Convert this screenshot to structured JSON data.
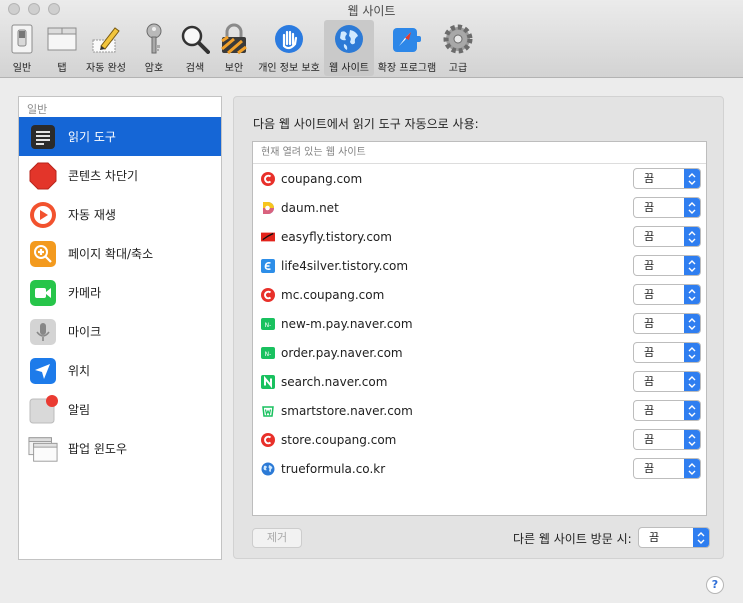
{
  "window": {
    "title": "웹 사이트"
  },
  "toolbar": {
    "items": [
      {
        "label": "일반",
        "icon": "general-switch-icon"
      },
      {
        "label": "탭",
        "icon": "tabs-icon"
      },
      {
        "label": "자동 완성",
        "icon": "pencil-form-icon"
      },
      {
        "label": "암호",
        "icon": "key-icon"
      },
      {
        "label": "검색",
        "icon": "magnifier-icon"
      },
      {
        "label": "보안",
        "icon": "padlock-icon"
      },
      {
        "label": "개인 정보 보호",
        "icon": "hand-icon"
      },
      {
        "label": "웹 사이트",
        "icon": "globe-icon"
      },
      {
        "label": "확장 프로그램",
        "icon": "extensions-icon"
      },
      {
        "label": "고급",
        "icon": "gear-icon"
      }
    ]
  },
  "sidebar": {
    "header": "일반",
    "items": [
      {
        "label": "읽기 도구",
        "icon": "reader-icon"
      },
      {
        "label": "콘텐츠 차단기",
        "icon": "stop-sign-icon"
      },
      {
        "label": "자동 재생",
        "icon": "play-icon"
      },
      {
        "label": "페이지 확대/축소",
        "icon": "zoom-icon"
      },
      {
        "label": "카메라",
        "icon": "camera-icon"
      },
      {
        "label": "마이크",
        "icon": "microphone-icon"
      },
      {
        "label": "위치",
        "icon": "location-icon"
      },
      {
        "label": "알림",
        "icon": "notification-icon"
      },
      {
        "label": "팝업 윈도우",
        "icon": "popup-window-icon"
      }
    ]
  },
  "main": {
    "heading": "다음 웹 사이트에서 읽기 도구 자동으로 사용:",
    "list_header": "현재 열려 있는 웹 사이트",
    "sites": [
      {
        "name": "coupang.com",
        "value": "끔",
        "favicon": "coupang-icon"
      },
      {
        "name": "daum.net",
        "value": "끔",
        "favicon": "daum-icon"
      },
      {
        "name": "easyfly.tistory.com",
        "value": "끔",
        "favicon": "easyfly-icon"
      },
      {
        "name": "life4silver.tistory.com",
        "value": "끔",
        "favicon": "life4silver-icon"
      },
      {
        "name": "mc.coupang.com",
        "value": "끔",
        "favicon": "coupang-icon"
      },
      {
        "name": "new-m.pay.naver.com",
        "value": "끔",
        "favicon": "naverpay-icon"
      },
      {
        "name": "order.pay.naver.com",
        "value": "끔",
        "favicon": "naverpay-icon"
      },
      {
        "name": "search.naver.com",
        "value": "끔",
        "favicon": "naver-icon"
      },
      {
        "name": "smartstore.naver.com",
        "value": "끔",
        "favicon": "smartstore-icon"
      },
      {
        "name": "store.coupang.com",
        "value": "끔",
        "favicon": "coupang-icon"
      },
      {
        "name": "trueformula.co.kr",
        "value": "끔",
        "favicon": "globe-icon"
      }
    ],
    "remove_label": "제거",
    "other_label": "다른 웹 사이트 방문 시:",
    "other_value": "끔"
  },
  "help": {
    "label": "?"
  },
  "colors": {
    "selection": "#1566d6",
    "popup_accent": "#2f7ef0",
    "coupang": "#e8302a",
    "naver": "#19c15f"
  }
}
